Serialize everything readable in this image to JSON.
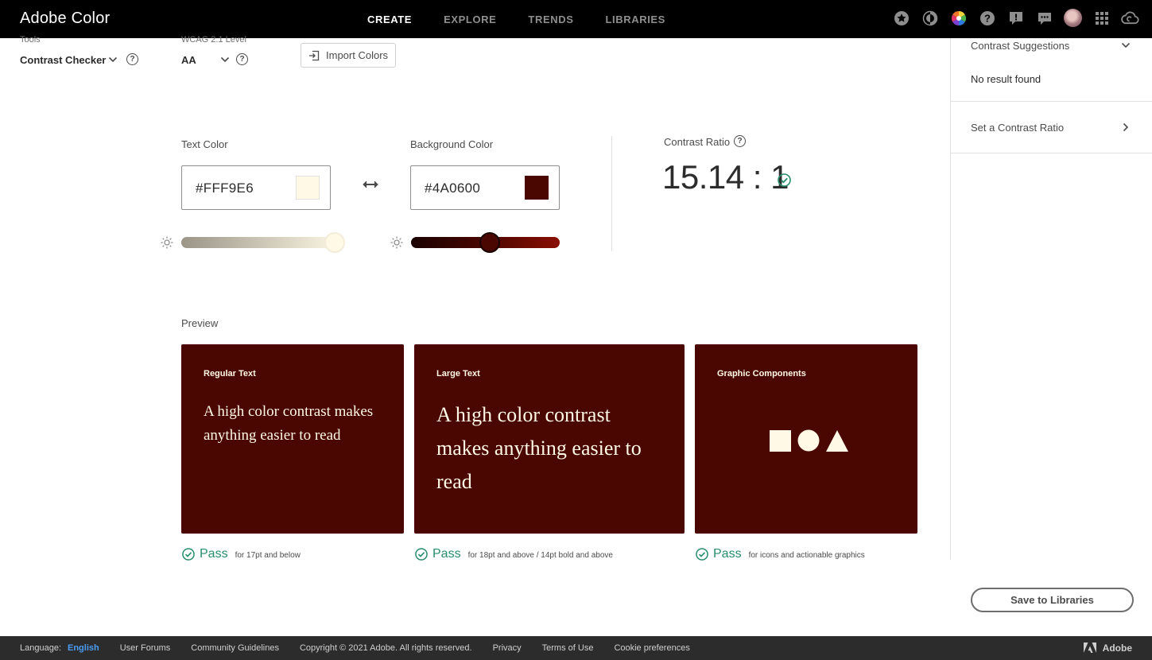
{
  "header": {
    "brand": "Adobe Color",
    "nav": [
      {
        "label": "CREATE",
        "active": true
      },
      {
        "label": "EXPLORE",
        "active": false
      },
      {
        "label": "TRENDS",
        "active": false
      },
      {
        "label": "LIBRARIES",
        "active": false
      }
    ],
    "icons": [
      "star-icon",
      "color-blind-icon",
      "color-wheel-icon",
      "help-icon",
      "feedback-icon",
      "chat-icon",
      "avatar",
      "apps-grid-icon",
      "creative-cloud-icon"
    ]
  },
  "toolbar": {
    "tools_label": "Tools",
    "tools_value": "Contrast Checker",
    "wcag_label": "WCAG 2.1 Level",
    "wcag_value": "AA",
    "import_label": "Import Colors"
  },
  "colors": {
    "text_label": "Text Color",
    "text_hex": "#FFF9E6",
    "background_label": "Background Color",
    "background_hex": "#4A0600",
    "text_brightness": 1.0,
    "background_brightness": 0.5
  },
  "contrast": {
    "label": "Contrast Ratio",
    "value": "15.14 : 1"
  },
  "preview": {
    "label": "Preview",
    "cards": [
      {
        "title": "Regular Text",
        "text": "A high color contrast makes anything easier to read",
        "pass": "Pass",
        "note": "for 17pt and below"
      },
      {
        "title": "Large Text",
        "text": "A high color contrast makes anything easier to read",
        "pass": "Pass",
        "note": "for 18pt and above / 14pt bold and above"
      },
      {
        "title": "Graphic Components",
        "shapes": [
          "square",
          "circle",
          "triangle"
        ],
        "pass": "Pass",
        "note": "for icons and actionable graphics"
      }
    ]
  },
  "side_panel": {
    "suggestions_label": "Contrast Suggestions",
    "no_result": "No result found",
    "set_ratio_label": "Set a Contrast Ratio",
    "save_label": "Save to Libraries"
  },
  "footer": {
    "language_label": "Language:",
    "language_value": "English",
    "links": [
      "User Forums",
      "Community Guidelines"
    ],
    "copyright": "Copyright © 2021 Adobe. All rights reserved.",
    "legal_links": [
      "Privacy",
      "Terms of Use",
      "Cookie preferences"
    ],
    "brand": "Adobe"
  },
  "theme": {
    "accent_green": "#268e6c",
    "header_bg": "#000000",
    "footer_bg": "#2c2c2c"
  }
}
